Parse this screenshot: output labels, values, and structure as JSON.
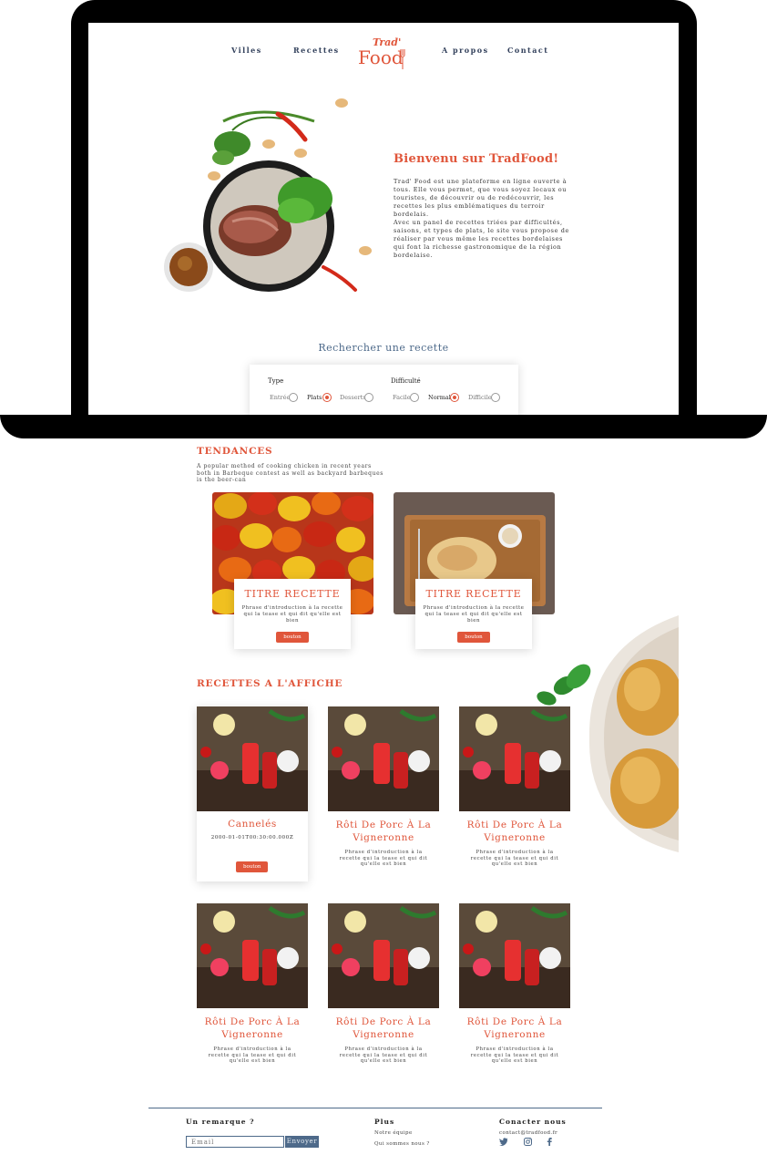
{
  "nav": {
    "villes": "Villes",
    "recettes": "Recettes",
    "apropos": "A propos",
    "contact": "Contact"
  },
  "logo": {
    "line1": "Trad'",
    "line2": "Food"
  },
  "hero": {
    "title": "Bienvenu sur TradFood!",
    "p1": "Trad' Food est une plateforme en ligne ouverte à tous. Elle vous permet, que vous soyez locaux ou touristes, de découvrir ou de redécouvrir, les recettes les plus emblématiques du terroir bordelais.",
    "p2": "Avec un panel de recettes triées par difficultés, saisons, et types de plats, le site vous propose de réaliser par vous même les recettes bordelaises qui font la richesse gastronomique de la région bordelaise."
  },
  "search": {
    "title": "Rechercher une recette",
    "type_label": "Type",
    "type_options": [
      "Entrée",
      "Plats",
      "Desserts"
    ],
    "type_selected": "Plats",
    "difficulty_label": "Difficulté",
    "difficulty_options": [
      "Facile",
      "Normal",
      "Difficile"
    ],
    "difficulty_selected": "Normal"
  },
  "tendances": {
    "title": "TENDANCES",
    "subtitle": "A popular method of cooking chicken in recent years both in Barbeque contest as well as backyard barbeques is the beer-can",
    "cards": [
      {
        "title": "TITRE RECETTE",
        "desc": "Phrase d'introduction à la recette qui la tease et qui dit qu'elle est bien",
        "button": "bouton"
      },
      {
        "title": "TITRE RECETTE",
        "desc": "Phrase d'introduction à la recette qui la tease et qui dit qu'elle est bien",
        "button": "bouton"
      }
    ]
  },
  "affiche": {
    "title": "RECETTES A L'AFFICHE",
    "featured": {
      "title": "Cannelés",
      "date": "2000-01-01T00:30:00.000Z",
      "button": "bouton"
    },
    "cards": [
      {
        "title": "Rôti De Porc À La Vigneronne",
        "desc": "Phrase d'introduction à la recette qui la tease et qui dit qu'elle est bien"
      },
      {
        "title": "Rôti De Porc À La Vigneronne",
        "desc": "Phrase d'introduction à la recette qui la tease et qui dit qu'elle est bien"
      },
      {
        "title": "Rôti De Porc À La Vigneronne",
        "desc": "Phrase d'introduction à la recette qui la tease et qui dit qu'elle est bien"
      },
      {
        "title": "Rôti De Porc À La Vigneronne",
        "desc": "Phrase d'introduction à la recette qui la tease et qui dit qu'elle est bien"
      },
      {
        "title": "Rôti De Porc À La Vigneronne",
        "desc": "Phrase d'introduction à la recette qui la tease et qui dit qu'elle est bien"
      }
    ]
  },
  "footer": {
    "remark_title": "Un remarque ?",
    "email_placeholder": "Email",
    "send_label": "Envoyer",
    "plus_title": "Plus",
    "plus_links": [
      "Notre équipe",
      "Qui sommes nous ?"
    ],
    "contact_title": "Conacter nous",
    "contact_email": "contact@tradfood.fr",
    "social_icons": [
      "twitter-icon",
      "instagram-icon",
      "facebook-icon"
    ]
  },
  "colors": {
    "accent": "#e0563b",
    "navy": "#33415c",
    "slate": "#4e6a8a"
  }
}
